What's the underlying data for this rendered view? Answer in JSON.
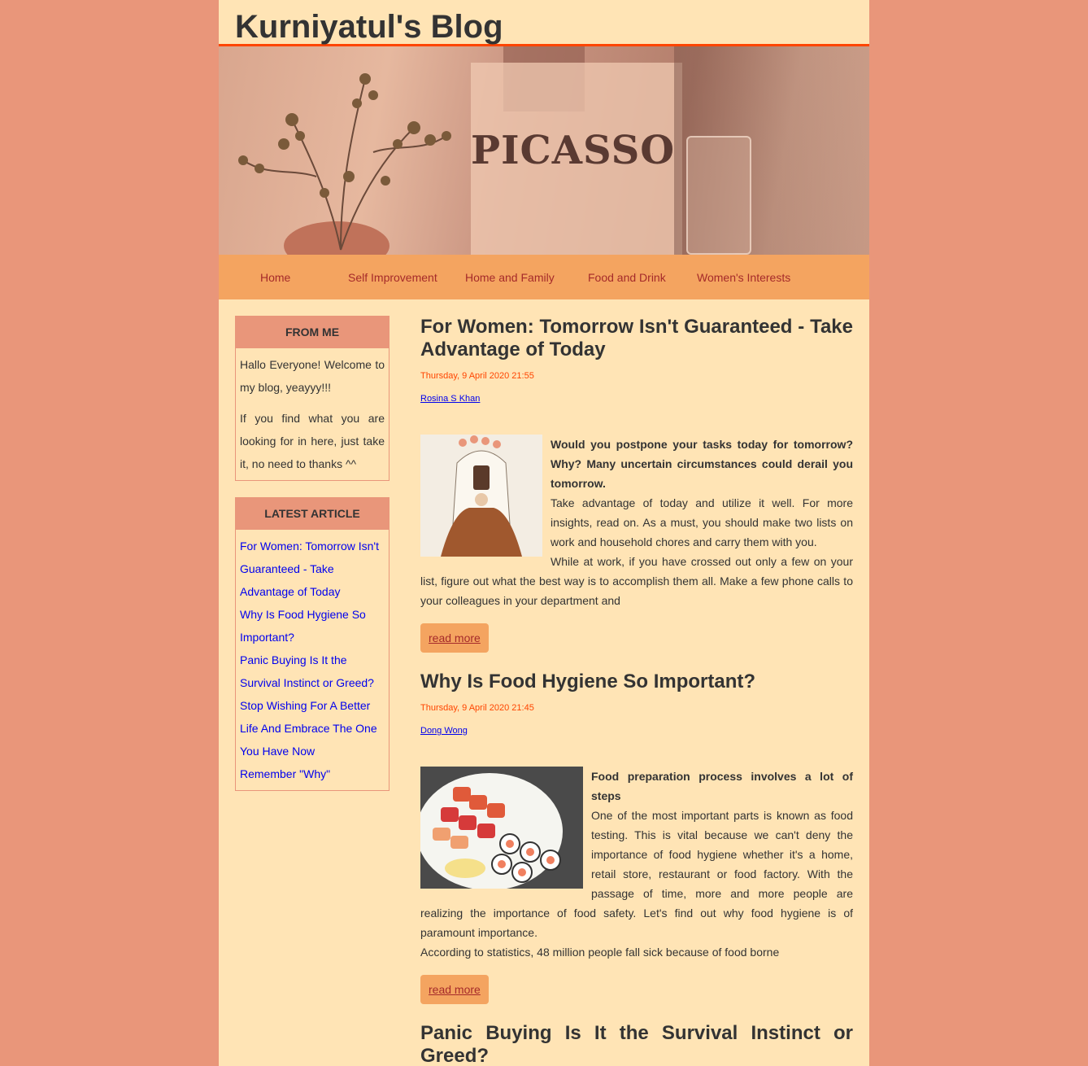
{
  "site": {
    "title": "Kurniyatul's Blog"
  },
  "banner": {
    "poster_text": "PICASSO"
  },
  "nav": {
    "items": [
      "Home",
      "Self Improvement",
      "Home and Family",
      "Food and Drink",
      "Women's Interests"
    ]
  },
  "sidebar": {
    "from_me": {
      "title": "FROM ME",
      "para1": "Hallo Everyone! Welcome to my blog, yeayyy!!!",
      "para2": "If you find what you are looking for in here, just take it, no need to thanks ^^"
    },
    "latest": {
      "title": "LATEST ARTICLE",
      "items": [
        "For Women: Tomorrow Isn't Guaranteed - Take Advantage of Today",
        "Why Is Food Hygiene So Important?",
        "Panic Buying Is It the Survival Instinct or Greed?",
        "Stop Wishing For A Better Life And Embrace The One You Have Now",
        "Remember \"Why\""
      ]
    }
  },
  "posts": [
    {
      "title": "For Women: Tomorrow Isn't Guaranteed - Take Advantage of Today",
      "date": "Thursday, 9 April 2020 21:55",
      "author": "Rosina S Khan",
      "lead": "Would you postpone your tasks today for tomorrow? Why? Many uncertain circumstances could derail you tomorrow.",
      "p1": "Take advantage of today and utilize it well. For more insights, read on. As a must, you should make two lists on work and household chores and carry them with you.",
      "p2": "While at work, if you have crossed out only a few on your list, figure out what the best way is to accomplish them all. Make a few phone calls to your colleagues in your department and",
      "read_more": "read more"
    },
    {
      "title": "Why Is Food Hygiene So Important?",
      "date": "Thursday, 9 April 2020 21:45",
      "author": "Dong Wong",
      "lead": "Food preparation process involves a lot of steps",
      "p1": "One of the most important parts is known as food testing. This is vital because we can't deny the importance of food hygiene whether it's a home, retail store, restaurant or food factory. With the passage of time, more and more people are realizing the importance of food safety. Let's find out why food hygiene is of paramount importance.",
      "p2": "According to statistics, 48 million people fall sick because of food borne",
      "read_more": "read more"
    },
    {
      "title": "Panic Buying Is It the Survival Instinct or Greed?"
    }
  ]
}
